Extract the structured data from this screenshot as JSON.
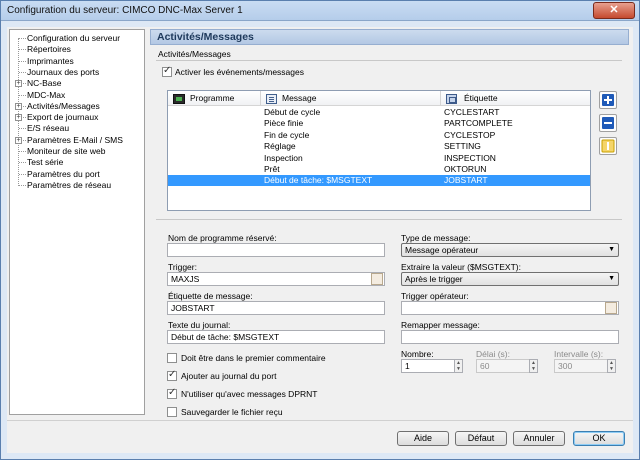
{
  "window": {
    "title": "Configuration du serveur: CIMCO DNC-Max Server 1",
    "close_glyph": "✕"
  },
  "tree": {
    "items": [
      {
        "label": "Configuration du serveur",
        "expandable": false
      },
      {
        "label": "Répertoires",
        "expandable": false
      },
      {
        "label": "Imprimantes",
        "expandable": false
      },
      {
        "label": "Journaux des ports",
        "expandable": false
      },
      {
        "label": "NC-Base",
        "expandable": true
      },
      {
        "label": "MDC-Max",
        "expandable": false
      },
      {
        "label": "Activités/Messages",
        "expandable": true
      },
      {
        "label": "Export de journaux",
        "expandable": true
      },
      {
        "label": "E/S réseau",
        "expandable": false
      },
      {
        "label": "Paramètres E-Mail / SMS",
        "expandable": true
      },
      {
        "label": "Moniteur de site web",
        "expandable": false
      },
      {
        "label": "Test série",
        "expandable": false
      },
      {
        "label": "Paramètres du port",
        "expandable": false
      },
      {
        "label": "Paramètres de réseau",
        "expandable": false
      }
    ]
  },
  "panel": {
    "header": "Activités/Messages",
    "group_title": "Activités/Messages",
    "enable_events": {
      "label": "Activer les événements/messages",
      "checked": true
    },
    "list": {
      "columns": [
        "Programme",
        "Message",
        "Étiquette"
      ],
      "rows": [
        {
          "program": "",
          "message": "Début de cycle",
          "tag": "CYCLESTART",
          "selected": false
        },
        {
          "program": "",
          "message": "Pièce finie",
          "tag": "PARTCOMPLETE",
          "selected": false
        },
        {
          "program": "",
          "message": "Fin de cycle",
          "tag": "CYCLESTOP",
          "selected": false
        },
        {
          "program": "",
          "message": "Réglage",
          "tag": "SETTING",
          "selected": false
        },
        {
          "program": "",
          "message": "Inspection",
          "tag": "INSPECTION",
          "selected": false
        },
        {
          "program": "",
          "message": "Prêt",
          "tag": "OKTORUN",
          "selected": false
        },
        {
          "program": "",
          "message": "Début de tâche: $MSGTEXT",
          "tag": "JOBSTART",
          "selected": true
        }
      ]
    },
    "side_buttons": [
      {
        "name": "add-button",
        "glyph": "+",
        "color": "#1f5ab8"
      },
      {
        "name": "remove-button",
        "glyph": "−",
        "color": "#1f5ab8"
      },
      {
        "name": "edit-button",
        "glyph": "✎",
        "color": "#d8a400"
      }
    ],
    "form": {
      "reserved_program": {
        "label": "Nom de programme réservé:",
        "value": ""
      },
      "trigger": {
        "label": "Trigger:",
        "value": "MAXJS"
      },
      "message_tag": {
        "label": "Étiquette de message:",
        "value": "JOBSTART"
      },
      "log_text": {
        "label": "Texte du journal:",
        "value": "Début de tâche: $MSGTEXT"
      },
      "message_type": {
        "label": "Type de message:",
        "value": "Message opérateur"
      },
      "extract_value": {
        "label": "Extraire la valeur ($MSGTEXT):",
        "value": "Après le trigger"
      },
      "operator_trigger": {
        "label": "Trigger opérateur:",
        "value": ""
      },
      "remap_message": {
        "label": "Remapper message:",
        "value": ""
      },
      "count": {
        "label": "Nombre:",
        "value": "1"
      },
      "delay": {
        "label": "Délai (s):",
        "value": "60"
      },
      "interval": {
        "label": "Intervalle (s):",
        "value": "300"
      },
      "checkboxes": [
        {
          "label": "Doit être dans le premier commentaire",
          "checked": false
        },
        {
          "label": "Ajouter au journal du port",
          "checked": true
        },
        {
          "label": "N'utiliser qu'avec messages DPRNT",
          "checked": true
        },
        {
          "label": "Sauvegarder le fichier reçu",
          "checked": false
        }
      ]
    }
  },
  "buttons": {
    "help": "Aide",
    "default": "Défaut",
    "cancel": "Annuler",
    "ok": "OK"
  },
  "colors": {
    "selection": "#3399ff",
    "header_text": "#1e395b"
  }
}
